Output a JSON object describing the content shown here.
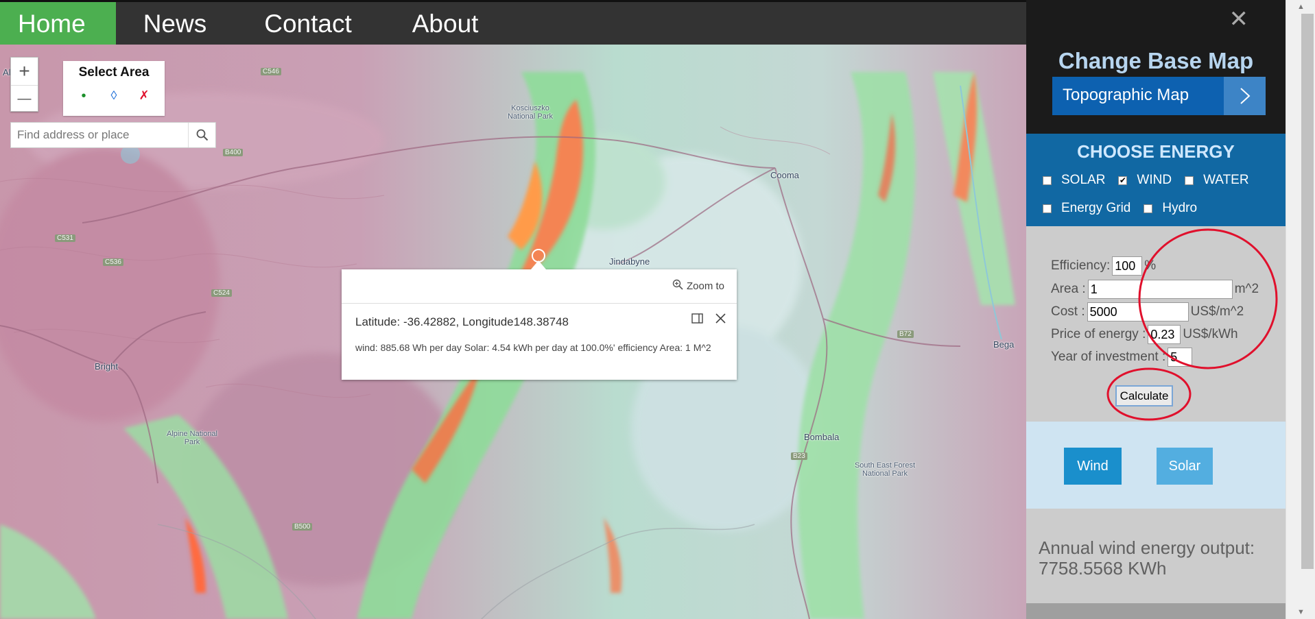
{
  "nav": {
    "items": [
      {
        "label": "Home",
        "active": true
      },
      {
        "label": "News"
      },
      {
        "label": "Contact"
      },
      {
        "label": "About"
      }
    ]
  },
  "map": {
    "zoom_in_label": "+",
    "zoom_out_label": "—",
    "select_area": {
      "title": "Select Area",
      "point_icon": "•",
      "polygon_icon": "◊",
      "clear_icon": "✗"
    },
    "search": {
      "placeholder": "Find address or place",
      "value": ""
    },
    "places": [
      "Albury",
      "Jindabyne",
      "Cooma",
      "Bright",
      "Bombala",
      "Bega",
      "Kosciuszko National Park",
      "Alpine National Park",
      "South East Forest National Park"
    ],
    "road_shields": [
      "B400",
      "C546",
      "C531",
      "C536",
      "B500",
      "B72",
      "B23",
      "C524",
      "B400"
    ]
  },
  "popup": {
    "zoom_to_label": "Zoom to",
    "title": "Latitude: -36.42882, Longitude148.38748",
    "body": "wind: 885.68 Wh per day Solar: 4.54 kWh per day at 100.0%' efficiency Area: 1 M^2"
  },
  "panel": {
    "close_icon": "✕",
    "base_map": {
      "title": "Change Base Map",
      "selected": "Topographic Map",
      "next_icon": ">"
    },
    "energy": {
      "title": "CHOOSE ENERGY",
      "options": [
        {
          "label": "SOLAR",
          "checked": false
        },
        {
          "label": "WIND",
          "checked": true
        },
        {
          "label": "WATER",
          "checked": false
        },
        {
          "label": "Energy Grid",
          "checked": false
        },
        {
          "label": "Hydro",
          "checked": false
        }
      ]
    },
    "calc": {
      "efficiency_label": "Efficiency:",
      "efficiency_value": "100",
      "efficiency_unit": "%",
      "area_label": "Area :",
      "area_value": "1",
      "area_unit": "m^2",
      "cost_label": "Cost :",
      "cost_value": "5000",
      "cost_unit": "US$/m^2",
      "price_label": "Price of energy :",
      "price_value": "0.23",
      "price_unit": "US$/kWh",
      "years_label": "Year of investment :",
      "years_value": "5",
      "calculate_label": "Calculate"
    },
    "charts": {
      "wind_label": "Wind",
      "solar_label": "Solar"
    },
    "result": "Annual wind energy output: 7758.5568 KWh"
  },
  "colors": {
    "nav_bg": "#333333",
    "nav_active": "#4CAF50",
    "base_select": "#0d61b0",
    "energy_bg": "#1168a3",
    "annotation": "#e0102c"
  }
}
